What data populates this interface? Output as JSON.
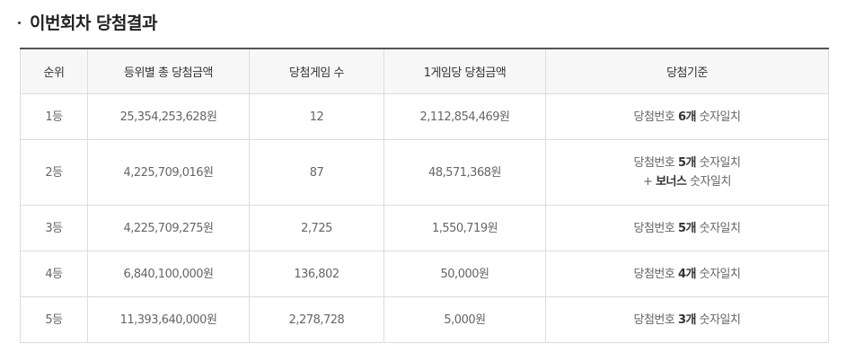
{
  "section": {
    "title": "이번회차 당첨결과"
  },
  "table": {
    "headers": [
      "순위",
      "등위별 총 당첨금액",
      "당첨게임 수",
      "1게임당 당첨금액",
      "당첨기준"
    ],
    "rows": [
      {
        "rank": "1등",
        "total": "25,354,253,628원",
        "winners": "12",
        "per_game": "2,112,854,469원",
        "criteria": {
          "prefix": "당첨번호 ",
          "count": "6개",
          "suffix": " 숫자일치"
        }
      },
      {
        "rank": "2등",
        "total": "4,225,709,016원",
        "winners": "87",
        "per_game": "48,571,368원",
        "criteria": {
          "prefix": "당첨번호 ",
          "count": "5개",
          "suffix": " 숫자일치",
          "bonus_prefix": "+ ",
          "bonus_word": "보너스",
          "bonus_suffix": " 숫자일치"
        }
      },
      {
        "rank": "3등",
        "total": "4,225,709,275원",
        "winners": "2,725",
        "per_game": "1,550,719원",
        "criteria": {
          "prefix": "당첨번호 ",
          "count": "5개",
          "suffix": " 숫자일치"
        }
      },
      {
        "rank": "4등",
        "total": "6,840,100,000원",
        "winners": "136,802",
        "per_game": "50,000원",
        "criteria": {
          "prefix": "당첨번호 ",
          "count": "4개",
          "suffix": " 숫자일치"
        }
      },
      {
        "rank": "5등",
        "total": "11,393,640,000원",
        "winners": "2,278,728",
        "per_game": "5,000원",
        "criteria": {
          "prefix": "당첨번호 ",
          "count": "3개",
          "suffix": " 숫자일치"
        }
      }
    ]
  }
}
